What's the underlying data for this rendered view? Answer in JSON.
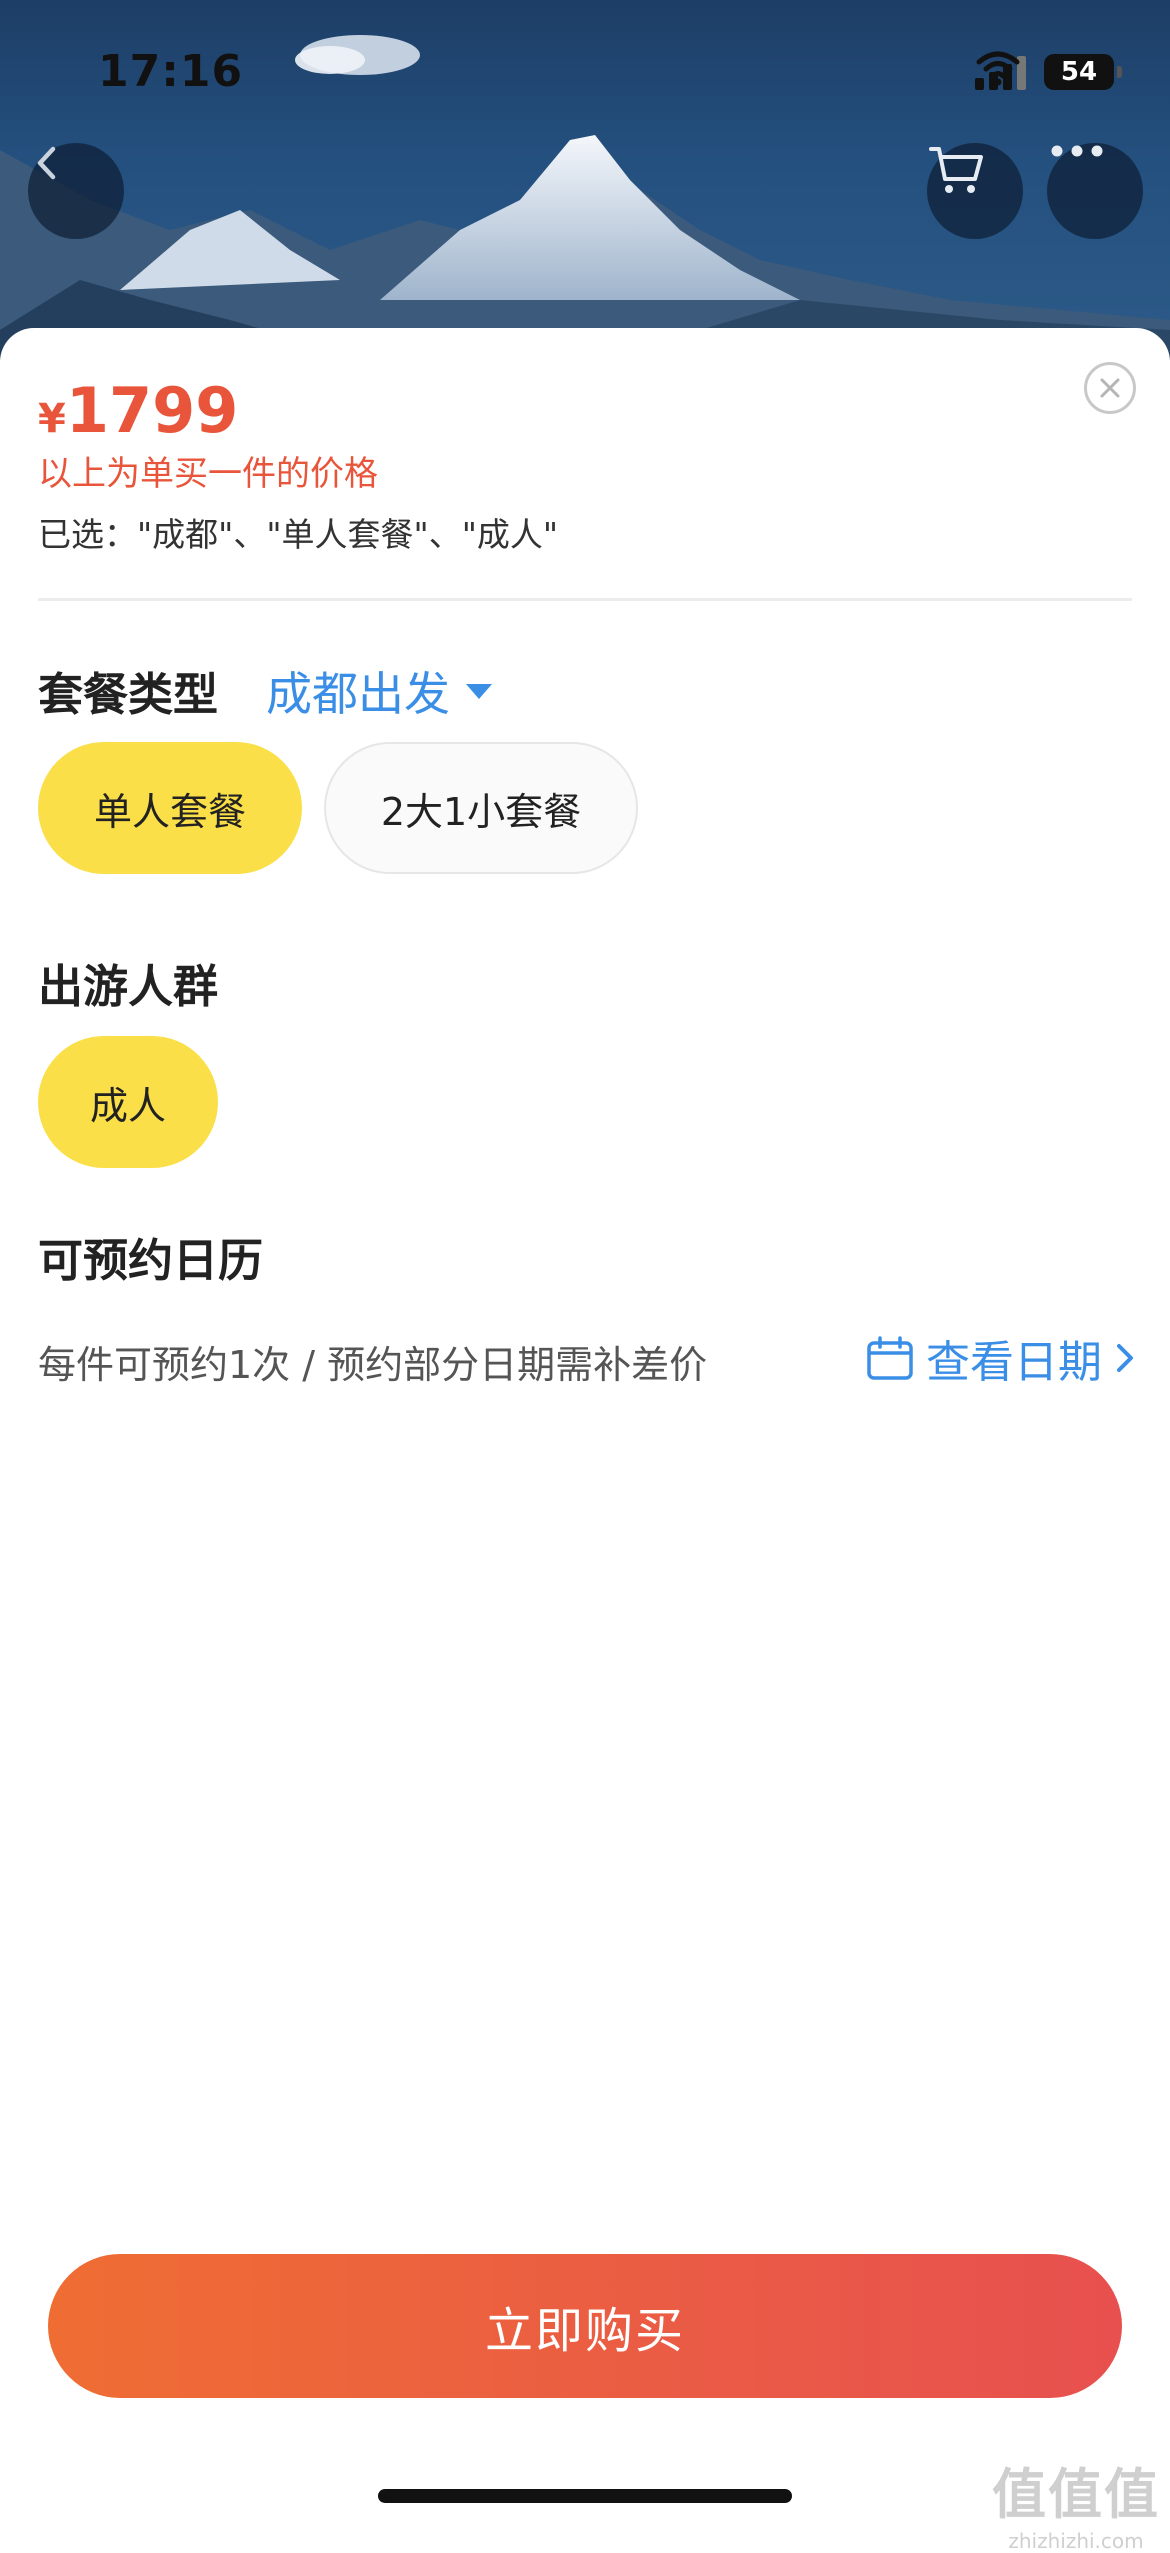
{
  "status_bar": {
    "time": "17:16",
    "battery": "54"
  },
  "product": {
    "currency": "¥",
    "price": "1799",
    "price_note": "以上为单买一件的价格",
    "selected_text": "已选：\"成都\"、\"单人套餐\"、\"成人\""
  },
  "package_type": {
    "title": "套餐类型",
    "departure": "成都出发",
    "options": [
      {
        "label": "单人套餐",
        "selected": true
      },
      {
        "label": "2大1小套餐",
        "selected": false
      }
    ]
  },
  "travelers": {
    "title": "出游人群",
    "options": [
      {
        "label": "成人",
        "selected": true
      }
    ]
  },
  "calendar": {
    "title": "可预约日历",
    "description": "每件可预约1次 / 预约部分日期需补差价",
    "link_label": "查看日期"
  },
  "buy_button": {
    "label": "立即购买"
  },
  "watermark": {
    "line1": "值值值",
    "line2": "zhizhizhi.com"
  },
  "colors": {
    "accent_red": "#e8553a",
    "link_blue": "#3a8ee6",
    "chip_yellow": "#fadf48"
  },
  "icons": {
    "back": "chevron-left-icon",
    "cart": "cart-icon",
    "more": "more-icon",
    "close": "close-icon",
    "calendar": "calendar-icon",
    "chevron_right": "chevron-right-icon"
  }
}
